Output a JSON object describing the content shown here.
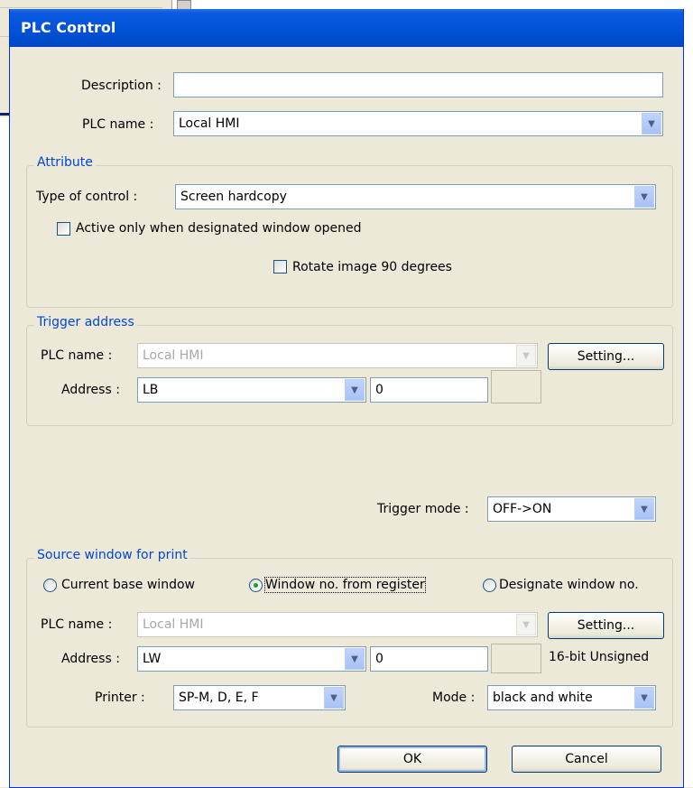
{
  "dialog": {
    "title": "PLC Control"
  },
  "top": {
    "description_label": "Description :",
    "description_value": "",
    "plc_name_label": "PLC name :",
    "plc_name_value": "Local HMI"
  },
  "attribute": {
    "title": "Attribute",
    "type_label": "Type of control :",
    "type_value": "Screen hardcopy",
    "active_only_label": "Active only when designated window opened",
    "active_only_checked": false,
    "rotate_label": "Rotate image 90 degrees",
    "rotate_checked": false
  },
  "trigger": {
    "title": "Trigger address",
    "plc_name_label": "PLC name :",
    "plc_name_value": "Local HMI",
    "setting_button": "Setting...",
    "address_label": "Address :",
    "address_device": "LB",
    "address_value": "0",
    "mode_label": "Trigger mode :",
    "mode_value": "OFF->ON"
  },
  "source": {
    "title": "Source window for print",
    "radio_current": "Current base window",
    "radio_register": "Window no. from register",
    "radio_designate": "Designate window no.",
    "selected": "register",
    "plc_name_label": "PLC name :",
    "plc_name_value": "Local HMI",
    "setting_button": "Setting...",
    "address_label": "Address :",
    "address_device": "LW",
    "address_value": "0",
    "data_type": "16-bit Unsigned",
    "printer_label": "Printer :",
    "printer_value": "SP-M, D, E, F",
    "mode_label": "Mode :",
    "mode_value": "black and white"
  },
  "buttons": {
    "ok": "OK",
    "cancel": "Cancel"
  },
  "icons": {
    "dropdown": "chevron-down-icon"
  },
  "colors": {
    "titlebar": "#0151d6",
    "group_title": "#0046d5",
    "face": "#ece9d8"
  }
}
